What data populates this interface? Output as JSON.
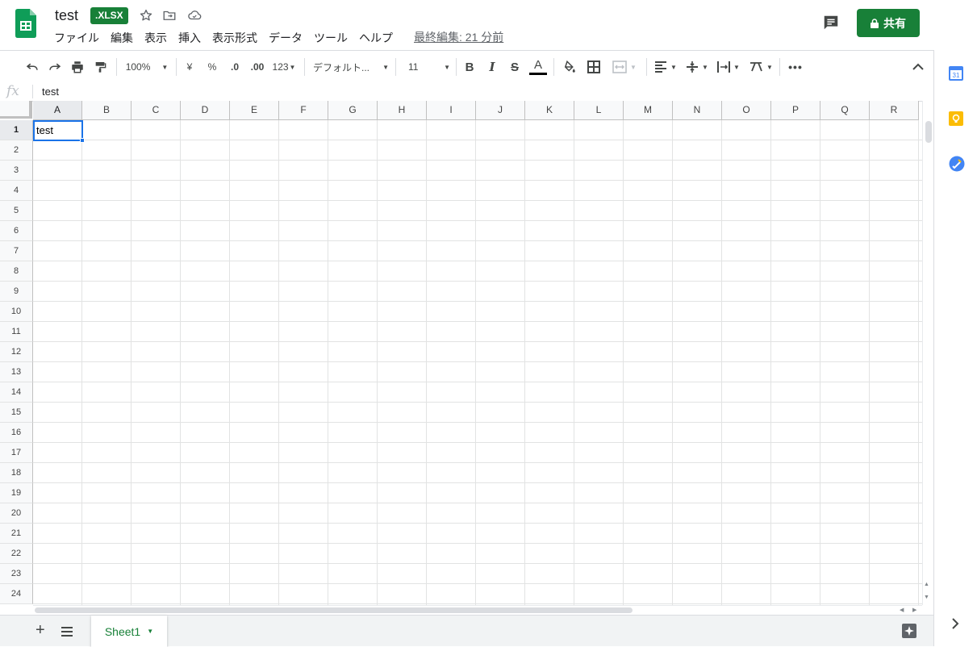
{
  "header": {
    "title": "test",
    "badge": ".XLSX",
    "last_edit": "最終編集: 21 分前",
    "share_label": "共有",
    "icons": [
      "sheets-logo-icon",
      "star-icon",
      "move-folder-icon",
      "cloud-status-icon",
      "comments-icon",
      "lock-icon"
    ]
  },
  "menu": {
    "items": [
      "ファイル",
      "編集",
      "表示",
      "挿入",
      "表示形式",
      "データ",
      "ツール",
      "ヘルプ"
    ]
  },
  "toolbar": {
    "zoom": "100%",
    "currency": "¥",
    "percent": "%",
    "decrease_decimal": ".0",
    "increase_decimal": ".00",
    "more_formats": "123",
    "font": "デフォルト...",
    "font_size": "11",
    "bold": "B",
    "italic": "I",
    "strike": "S",
    "text_color": "A",
    "text_color_bar": "#000000"
  },
  "formula_bar": {
    "fx": "fx",
    "value": "test"
  },
  "grid": {
    "columns": [
      "A",
      "B",
      "C",
      "D",
      "E",
      "F",
      "G",
      "H",
      "I",
      "J",
      "K",
      "L",
      "M",
      "N",
      "O",
      "P",
      "Q",
      "R"
    ],
    "rows": [
      "1",
      "2",
      "3",
      "4",
      "5",
      "6",
      "7",
      "8",
      "9",
      "10",
      "11",
      "12",
      "13",
      "14",
      "15",
      "16",
      "17",
      "18",
      "19",
      "20",
      "21",
      "22",
      "23",
      "24"
    ],
    "selected_cell": "A1",
    "cells": {
      "A1": "test"
    }
  },
  "sheets": {
    "tabs": [
      "Sheet1"
    ],
    "active": "Sheet1"
  },
  "colors": {
    "brand_green": "#188038",
    "selection_blue": "#1a73e8"
  }
}
